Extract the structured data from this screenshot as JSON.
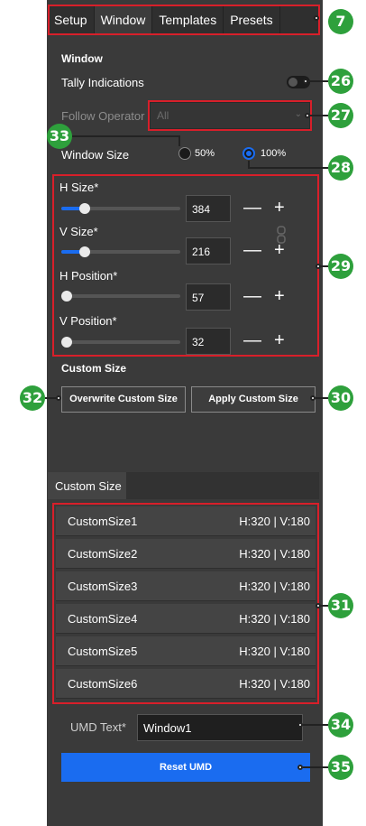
{
  "tabs": [
    "Setup",
    "Window",
    "Templates",
    "Presets"
  ],
  "active_tab": "Window",
  "window_section": {
    "title": "Window",
    "tally_label": "Tally Indications",
    "tally_on": false,
    "follow_operator_label": "Follow Operator",
    "follow_operator_value": "All",
    "window_size_label": "Window Size",
    "size_option_50": "50%",
    "size_option_100": "100%",
    "selected_size": "100%"
  },
  "size_controls": [
    {
      "label": "H Size*",
      "value": "384",
      "fraction": 0.2
    },
    {
      "label": "V Size*",
      "value": "216",
      "fraction": 0.2
    },
    {
      "label": "H Position*",
      "value": "57",
      "fraction": 0.0
    },
    {
      "label": "V Position*",
      "value": "32",
      "fraction": 0.0
    }
  ],
  "custom_size": {
    "title": "Custom Size",
    "overwrite_label": "Overwrite Custom Size",
    "apply_label": "Apply Custom Size",
    "tab_label": "Custom Size",
    "items": [
      {
        "name": "CustomSize1",
        "dims": "H:320  |  V:180"
      },
      {
        "name": "CustomSize2",
        "dims": "H:320  |  V:180"
      },
      {
        "name": "CustomSize3",
        "dims": "H:320  |  V:180"
      },
      {
        "name": "CustomSize4",
        "dims": "H:320  |  V:180"
      },
      {
        "name": "CustomSize5",
        "dims": "H:320  |  V:180"
      },
      {
        "name": "CustomSize6",
        "dims": "H:320  |  V:180"
      }
    ]
  },
  "umd": {
    "label": "UMD Text*",
    "value": "Window1",
    "reset_label": "Reset UMD"
  },
  "callouts": [
    "7",
    "26",
    "27",
    "33",
    "28",
    "29",
    "32",
    "30",
    "31",
    "34",
    "35"
  ],
  "colors": {
    "panel": "#3a3a3a",
    "accent": "#1a6cf0",
    "callout_green": "#2ea03c",
    "frame_red": "#d81f2a"
  }
}
